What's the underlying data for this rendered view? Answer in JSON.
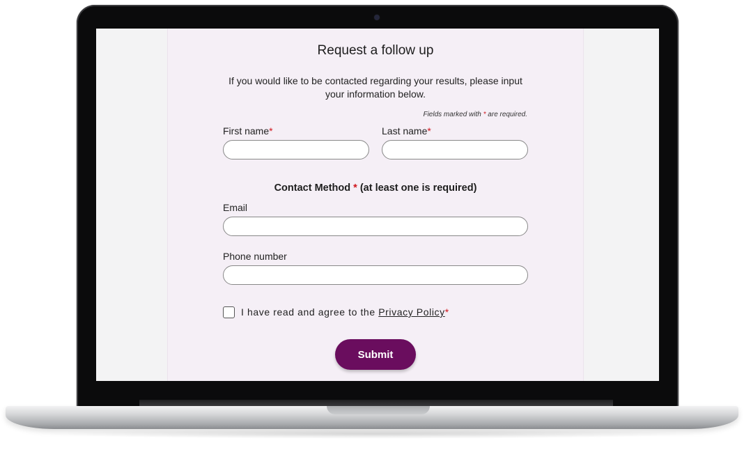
{
  "form": {
    "title": "Request a follow up",
    "intro": "If you would like to be contacted regarding your results, please input your information below.",
    "required_note_prefix": "Fields marked with",
    "required_note_suffix": "are required.",
    "required_marker": "*",
    "first_name": {
      "label": "First name",
      "value": "",
      "placeholder": ""
    },
    "last_name": {
      "label": "Last name",
      "value": "",
      "placeholder": ""
    },
    "contact_method": {
      "heading": "Contact Method",
      "heading_suffix": "(at least one is required)"
    },
    "email": {
      "label": "Email",
      "value": "",
      "placeholder": ""
    },
    "phone": {
      "label": "Phone number",
      "value": "",
      "placeholder": ""
    },
    "consent": {
      "checked": false,
      "text": "I have read and agree to the",
      "link_text": "Privacy Policy"
    },
    "submit_label": "Submit"
  },
  "colors": {
    "accent": "#6a0d5e",
    "required_star": "#d0161d",
    "panel_background": "#f5eff6"
  }
}
